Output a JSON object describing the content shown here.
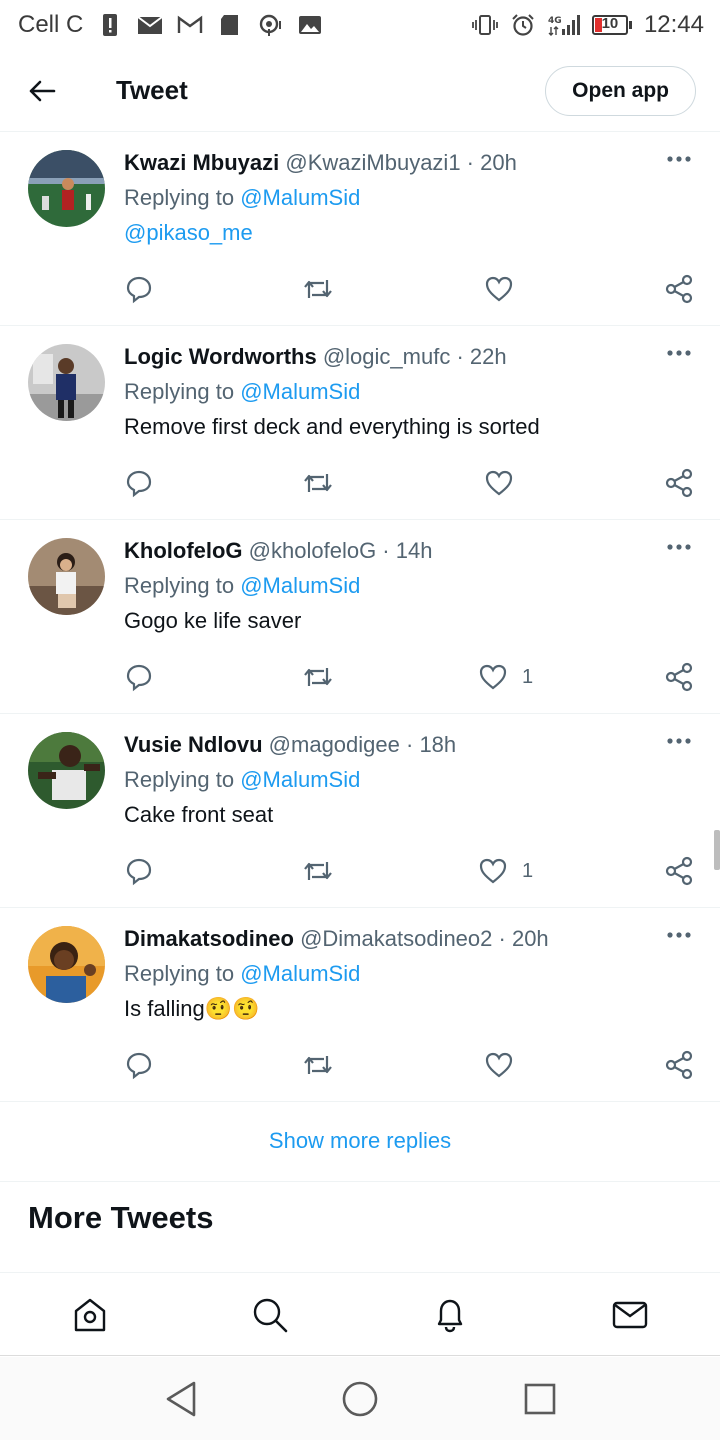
{
  "status_bar": {
    "carrier": "Cell C",
    "battery_level": "10",
    "time": "12:44",
    "network": "4G",
    "icons": [
      "alert-icon",
      "gmail-icon",
      "m-mail-icon",
      "sd-card-icon",
      "hotspot-icon",
      "image-icon",
      "vibrate-icon",
      "alarm-icon",
      "signal-icon",
      "battery-icon"
    ]
  },
  "header": {
    "title": "Tweet",
    "open_app_label": "Open app"
  },
  "replies": [
    {
      "name": "Kwazi Mbuyazi",
      "handle": "@KwaziMbuyazi1",
      "time": "20h",
      "replying_prefix": "Replying to",
      "replying_to": "@MalumSid",
      "text": "",
      "text_mention": "@pikaso_me",
      "likes": ""
    },
    {
      "name": "Logic Wordworths",
      "handle": "@logic_mufc",
      "time": "22h",
      "replying_prefix": "Replying to",
      "replying_to": "@MalumSid",
      "text": "Remove first deck and everything is sorted",
      "text_mention": "",
      "likes": ""
    },
    {
      "name": "KholofeloG",
      "handle": "@kholofeloG",
      "time": "14h",
      "replying_prefix": "Replying to",
      "replying_to": "@MalumSid",
      "text": "Gogo ke life saver",
      "text_mention": "",
      "likes": "1"
    },
    {
      "name": "Vusie Ndlovu",
      "handle": "@magodigee",
      "time": "18h",
      "replying_prefix": "Replying to",
      "replying_to": "@MalumSid",
      "text": "Cake front seat",
      "text_mention": "",
      "likes": "1"
    },
    {
      "name": "Dimakatsodineo",
      "handle": "@Dimakatsodineo2",
      "time": "20h",
      "replying_prefix": "Replying to",
      "replying_to": "@MalumSid",
      "text": "Is falling🤨🤨",
      "text_mention": "",
      "likes": ""
    }
  ],
  "show_more_label": "Show more replies",
  "more_tweets_heading": "More Tweets",
  "bottom_nav": [
    "home-icon",
    "search-icon",
    "notifications-icon",
    "messages-icon"
  ],
  "system_nav": [
    "back-triangle-icon",
    "home-circle-icon",
    "recents-square-icon"
  ],
  "colors": {
    "accent": "#1d9bf0",
    "secondary_text": "#536471",
    "primary_text": "#0f1419"
  }
}
